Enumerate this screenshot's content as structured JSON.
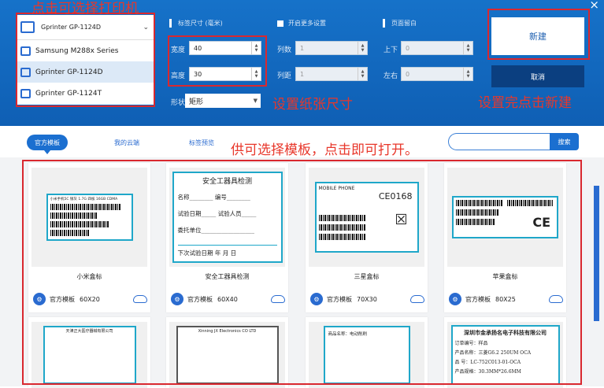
{
  "window": {
    "close_glyph": "×"
  },
  "annotations": {
    "printer": "点击可选择打印机",
    "paper": "设置纸张尺寸",
    "new": "设置完点击新建",
    "template": "供可选择模板，点击即可打开。"
  },
  "printer": {
    "selected": "Gprinter GP-1124D",
    "options": [
      "Samsung M288x Series",
      "Gprinter GP-1124D",
      "Gprinter  GP-1124T"
    ],
    "highlight_index": 1
  },
  "label_size": {
    "section_title": "标签尺寸 (毫米)",
    "width_label": "宽度",
    "width_value": "40",
    "height_label": "高度",
    "height_value": "30",
    "shape_label": "形状",
    "shape_value": "矩形"
  },
  "more": {
    "section_title": "开启更多设置",
    "cols_label": "列数",
    "cols_value": "1",
    "colgap_label": "列距",
    "colgap_value": "1"
  },
  "margin": {
    "section_title": "页面留白",
    "topbottom_label": "上下",
    "topbottom_value": "0",
    "leftright_label": "左右",
    "leftright_value": "0"
  },
  "buttons": {
    "new": "新建",
    "cancel": "取消",
    "search": "搜索"
  },
  "tabs": [
    "官方模板",
    "我的云端",
    "标签预览"
  ],
  "templates": [
    {
      "name": "小米盒标",
      "source": "官方模板",
      "size": "60X20"
    },
    {
      "name": "安全工器具检测",
      "source": "官方模板",
      "size": "60X40"
    },
    {
      "name": "三星盒标",
      "source": "官方模板",
      "size": "70X30"
    },
    {
      "name": "苹果盒标",
      "source": "官方模板",
      "size": "80X25"
    }
  ],
  "thumb_text": {
    "mi_title": "小米手机5C 银灰 1.7G 四核 16GB CDMA",
    "safety_title": "安全工器具检测",
    "safety_rows": [
      "名称________ 编号________",
      "试验日期_____ 试验人员_____",
      "委托单位__________________",
      "下次试验日期   年   月   日"
    ],
    "samsung_title": "MOBILE PHONE",
    "samsung_code": "CE0168",
    "apple_ce": "CE",
    "tianjin_title": "天津正大医疗器械有限公司",
    "xinning_title": "Xinning JX Electronics CO LTD",
    "product_label": "商品名称：电动削刷",
    "shenzhen_title": "深圳市金承扬名电子科技有限公司",
    "shenzhen_rows": [
      "订单编号：样品",
      "产品名称：三菱G6.2    250UM OCA",
      "品    号：LC-752C013-01-OCA",
      "产品规格：30.3MM*26.6MM"
    ]
  },
  "colors": {
    "accent": "#1b6fd0",
    "annotation": "#e8372b",
    "header_bg": "#1672c9"
  }
}
